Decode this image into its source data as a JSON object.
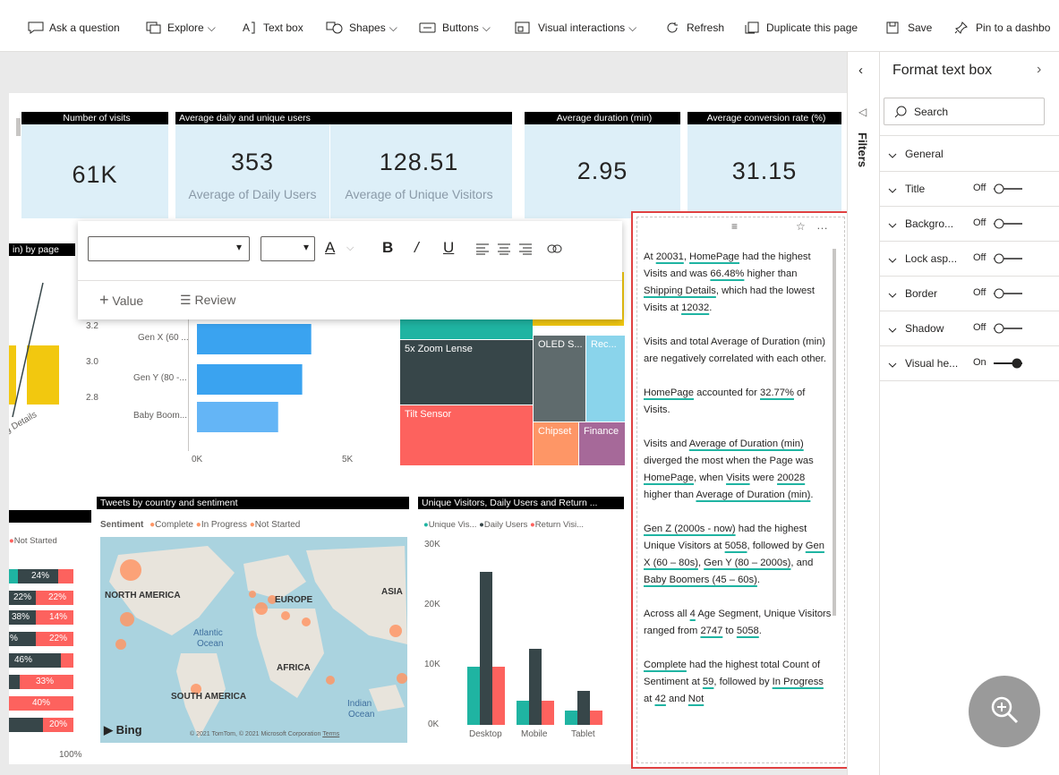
{
  "toolbar": {
    "items": [
      "Ask a question",
      "Explore",
      "Text box",
      "Shapes",
      "Buttons",
      "Visual interactions",
      "Refresh",
      "Duplicate this page",
      "Save",
      "Pin to a dashbo"
    ]
  },
  "cards": {
    "visits": {
      "title": "Number of visits",
      "value": "61K"
    },
    "users": {
      "title": "Average daily and unique users",
      "daily_value": "353",
      "daily_label": "Average of Daily Users",
      "unique_value": "128.51",
      "unique_label": "Average of Unique Visitors"
    },
    "duration": {
      "title": "Average duration (min)",
      "value": "2.95"
    },
    "conversion": {
      "title": "Average  conversion rate (%)",
      "value": "31.15"
    }
  },
  "left_chart": {
    "title": "in) by page",
    "ticks": [
      "3.2",
      "3.0",
      "2.8"
    ],
    "xlabel": "g Details"
  },
  "bar_chart": {
    "categories": [
      "Gen X (60 ...",
      "Gen Y (80 -...",
      "Baby Boom..."
    ],
    "values": [
      3800,
      3500,
      2700
    ],
    "xticks": [
      "0K",
      "5K"
    ]
  },
  "format_popup": {
    "value_label": "Value",
    "review_label": "Review",
    "color_letter": "A"
  },
  "treemap": {
    "tiles": [
      "5x Zoom Lense",
      "OLED S...",
      "Rec...",
      "Tilt Sensor",
      "Chipset",
      "Finance"
    ]
  },
  "sentiment_left": {
    "legend": "Not Started",
    "rows": [
      [
        "24%"
      ],
      [
        "22%",
        "22%"
      ],
      [
        "38%",
        "14%"
      ],
      [
        "%",
        "22%"
      ],
      [
        "46%"
      ],
      [
        "33%"
      ],
      [
        "40%"
      ],
      [
        "20%"
      ]
    ],
    "axis": "100%"
  },
  "map": {
    "title": "Tweets by country and sentiment",
    "legend_label": "Sentiment",
    "legend": [
      "Complete",
      "In Progress",
      "Not Started"
    ],
    "labels": [
      "NORTH AMERICA",
      "EUROPE",
      "ASIA",
      "Atlantic",
      "Ocean",
      "AFRICA",
      "SOUTH AMERICA",
      "Indian",
      "Ocean"
    ],
    "bing": "Bing",
    "copyright": "© 2021 TomTom, © 2021 Microsoft Corporation",
    "terms": "Terms"
  },
  "column_chart": {
    "title": "Unique Visitors, Daily Users and Return ...",
    "legend": [
      "Unique Vis...",
      "Daily Users",
      "Return Visi..."
    ],
    "yticks": [
      "30K",
      "20K",
      "10K",
      "0K"
    ],
    "categories": [
      "Desktop",
      "Mobile",
      "Tablet"
    ]
  },
  "textbox": {
    "paragraphs": [
      "At 20031, HomePage had the highest Visits and was 66.48% higher than Shipping Details, which had the lowest Visits at 12032.",
      "Visits and total Average of Duration (min) are negatively correlated with each other.",
      "HomePage accounted for 32.77% of Visits.",
      "Visits and Average of Duration (min) diverged the most when the Page was HomePage, when Visits were 20028 higher than Average of Duration (min).",
      "Gen Z (2000s - now) had the highest Unique Visitors at 5058, followed by Gen X (60 – 80s), Gen Y (80 – 2000s), and Baby Boomers (45 – 60s).",
      "Across all 4 Age Segment, Unique Visitors ranged from 2747 to 5058.",
      "Complete had the highest total Count of Sentiment at 59, followed by In Progress at 42 and Not"
    ]
  },
  "filters": {
    "label": "Filters"
  },
  "format_pane": {
    "title": "Format text box",
    "search_placeholder": "Search",
    "sections": [
      {
        "label": "General",
        "state": ""
      },
      {
        "label": "Title",
        "state": "Off"
      },
      {
        "label": "Backgro...",
        "state": "Off"
      },
      {
        "label": "Lock asp...",
        "state": "Off"
      },
      {
        "label": "Border",
        "state": "Off"
      },
      {
        "label": "Shadow",
        "state": "Off"
      },
      {
        "label": "Visual he...",
        "state": "On"
      }
    ]
  },
  "colors": {
    "accent_teal": "#1fb4a2",
    "dark": "#374649",
    "red": "#fd625e",
    "yellow": "#f2c80f",
    "orange": "#fe9666",
    "blue": "#3aa3f0",
    "highlight": "#e04141"
  }
}
